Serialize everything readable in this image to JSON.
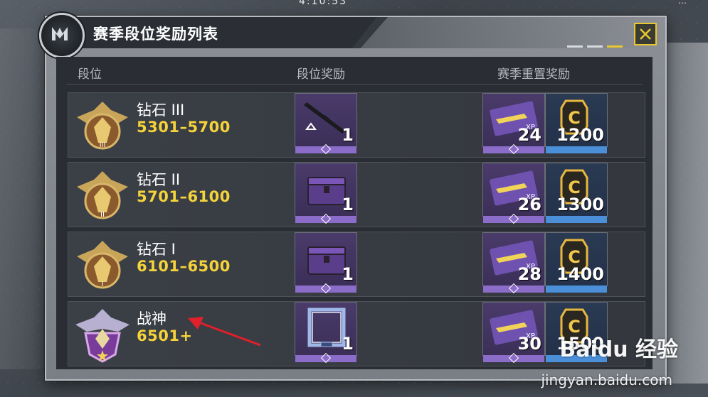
{
  "status_bar": {
    "center": "4:10:53",
    "right": "…"
  },
  "panel": {
    "title": "赛季段位奖励列表",
    "close_icon": "close-x-icon",
    "page_indicator": {
      "pages": 3,
      "active": 3
    }
  },
  "columns": {
    "rank": "段位",
    "rank_reward": "段位奖励",
    "season_reset_reward": "赛季重置奖励"
  },
  "rows": [
    {
      "name": "钻石 III",
      "range": "5301–5700",
      "rank_reward": {
        "icon": "rifle-blueprint-icon",
        "qty": "1"
      },
      "xp_card_qty": "24",
      "credits_qty": "1200"
    },
    {
      "name": "钻石 II",
      "range": "5701–6100",
      "rank_reward": {
        "icon": "supply-crate-icon",
        "qty": "1"
      },
      "xp_card_qty": "26",
      "credits_qty": "1300"
    },
    {
      "name": "钻石 I",
      "range": "6101–6500",
      "rank_reward": {
        "icon": "supply-crate-icon",
        "qty": "1"
      },
      "xp_card_qty": "28",
      "credits_qty": "1400"
    },
    {
      "name": "战神",
      "range": "6501+",
      "rank_reward": {
        "icon": "avatar-frame-icon",
        "qty": "1"
      },
      "xp_card_qty": "30",
      "credits_qty": "1500"
    }
  ],
  "watermark": {
    "brand": "Baidu 经验",
    "url": "jingyan.baidu.com"
  },
  "colors": {
    "accent_yellow": "#f5d33a",
    "purple_tile": "#4a3b6a",
    "blue_tile": "#2a3a52",
    "close_border": "#e8c830"
  }
}
